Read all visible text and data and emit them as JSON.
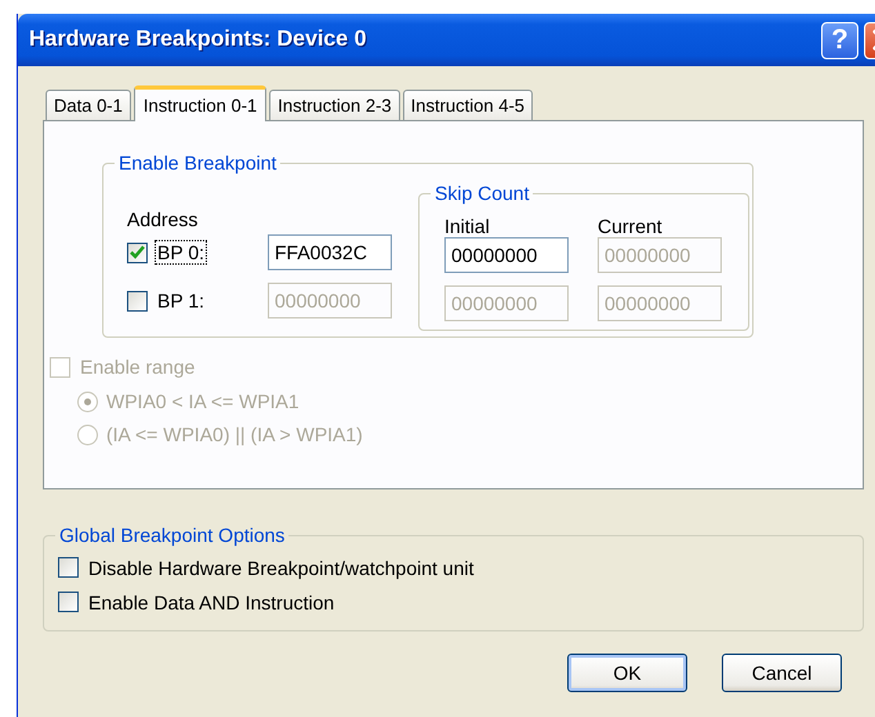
{
  "window": {
    "title": "Hardware Breakpoints: Device 0",
    "help_button": "?"
  },
  "tabs": [
    {
      "label": "Data 0-1",
      "selected": false
    },
    {
      "label": "Instruction 0-1",
      "selected": true
    },
    {
      "label": "Instruction 2-3",
      "selected": false
    },
    {
      "label": "Instruction 4-5",
      "selected": false
    }
  ],
  "enable_breakpoint": {
    "title": "Enable Breakpoint",
    "address_header": "Address",
    "skip_count": {
      "title": "Skip Count",
      "initial_header": "Initial",
      "current_header": "Current"
    },
    "rows": [
      {
        "label": "BP 0:",
        "checked": true,
        "focused": true,
        "address": {
          "value": "FFA0032C",
          "disabled": false
        },
        "initial": {
          "value": "00000000",
          "disabled": false
        },
        "current": {
          "value": "00000000",
          "disabled": true
        }
      },
      {
        "label": "BP 1:",
        "checked": false,
        "focused": false,
        "address": {
          "value": "00000000",
          "disabled": true
        },
        "initial": {
          "value": "00000000",
          "disabled": true
        },
        "current": {
          "value": "00000000",
          "disabled": true
        }
      }
    ]
  },
  "range": {
    "label": "Enable range",
    "checked": false,
    "disabled": true,
    "options": [
      {
        "label": "WPIA0 < IA <= WPIA1",
        "selected": true,
        "disabled": true
      },
      {
        "label": "(IA <= WPIA0) || (IA > WPIA1)",
        "selected": false,
        "disabled": true
      }
    ]
  },
  "global_options": {
    "title": "Global Breakpoint Options",
    "options": [
      {
        "label": "Disable Hardware Breakpoint/watchpoint unit",
        "checked": false
      },
      {
        "label": "Enable Data AND Instruction",
        "checked": false
      }
    ]
  },
  "buttons": [
    {
      "label": "OK",
      "default": true
    },
    {
      "label": "Cancel",
      "default": false
    }
  ]
}
